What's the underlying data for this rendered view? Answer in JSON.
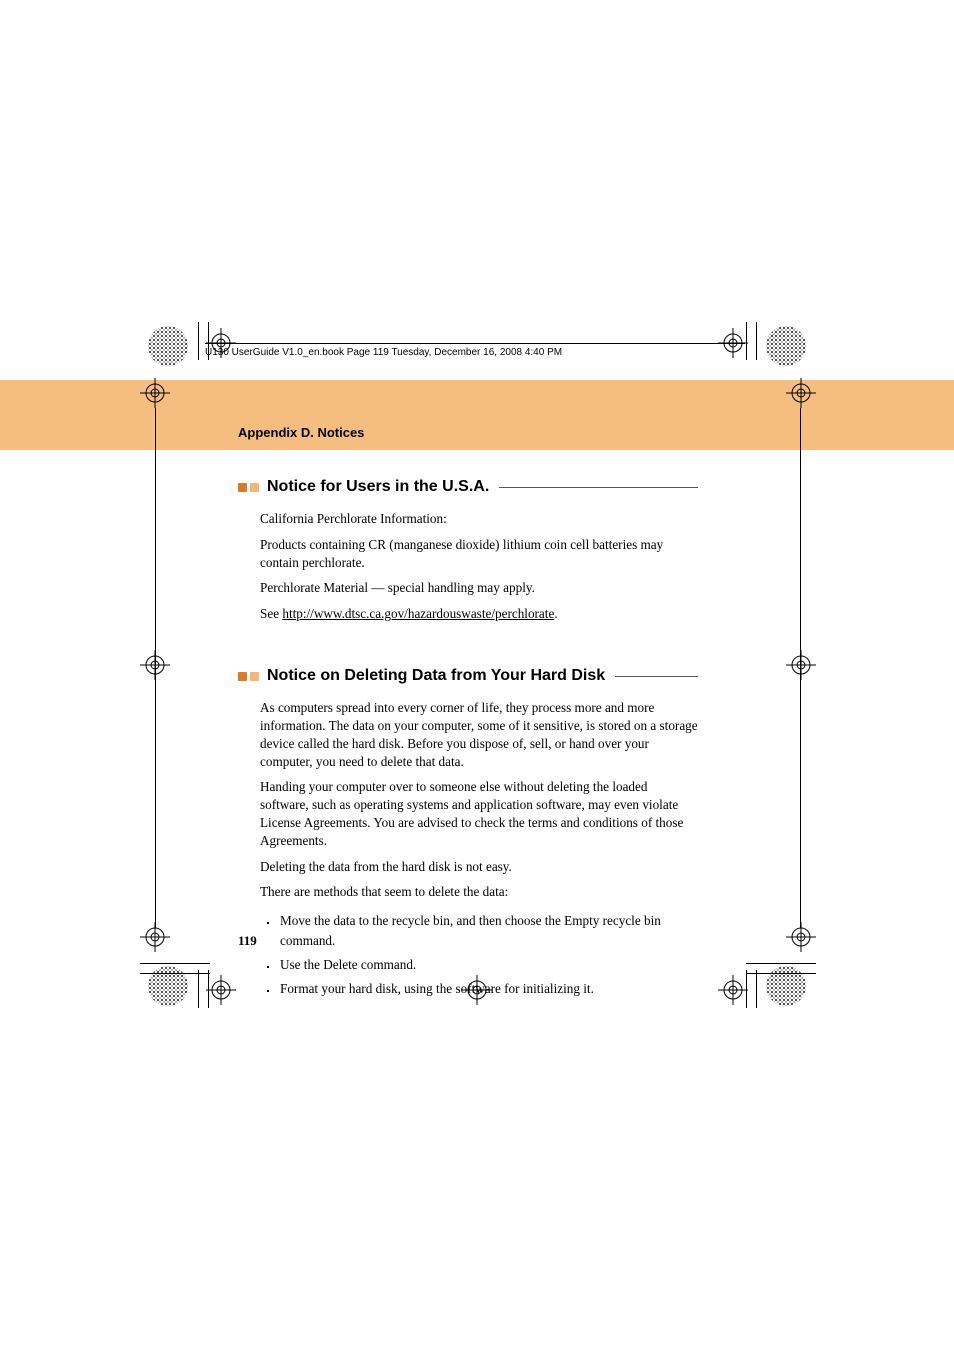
{
  "header": {
    "file_strip": "U130 UserGuide V1.0_en.book  Page 119  Tuesday, December 16, 2008  4:40 PM"
  },
  "appendix_title": "Appendix D. Notices",
  "section1": {
    "title": "Notice for Users in the U.S.A.",
    "p1": "California Perchlorate Information:",
    "p2": "Products containing CR (manganese dioxide) lithium coin cell batteries may contain perchlorate.",
    "p3": "Perchlorate Material — special handling may apply.",
    "p4_pre": "See ",
    "p4_link": "http://www.dtsc.ca.gov/hazardouswaste/perchlorate",
    "p4_post": "."
  },
  "section2": {
    "title": "Notice on Deleting Data from Your Hard Disk",
    "p1": "As computers spread into every corner of life, they process more and more information. The data on your computer, some of it sensitive, is stored on a storage device called the hard disk. Before you dispose of, sell, or hand over your computer, you need to delete that data.",
    "p2": "Handing your computer over to someone else without deleting the loaded software, such as operating systems and application software, may even violate License Agreements. You are advised to check the terms and conditions of those Agreements.",
    "p3": "Deleting the data from the hard disk is not easy.",
    "p4": "There are methods that seem to delete the data:",
    "bullets": [
      "Move the data to the recycle bin, and then choose the Empty recycle bin command.",
      "Use the Delete command.",
      "Format your hard disk, using the software for initializing it."
    ]
  },
  "page_number": "119",
  "marks": {
    "crosshair_icon": "registration-mark-icon",
    "moire_icon": "moire-target-icon"
  }
}
